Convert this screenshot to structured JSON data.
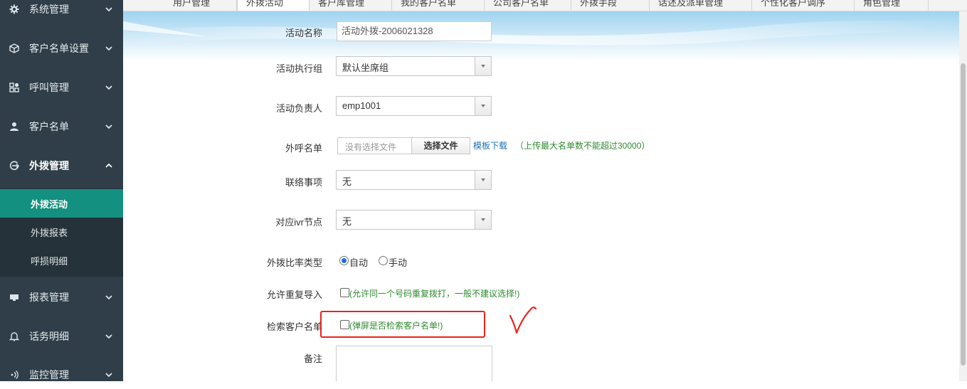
{
  "sidebar": {
    "items": [
      {
        "label": "系统管理",
        "icon": "gear-icon"
      },
      {
        "label": "客户名单设置",
        "icon": "cube-icon"
      },
      {
        "label": "呼叫管理",
        "icon": "grid-icon"
      },
      {
        "label": "客户名单",
        "icon": "user-icon"
      },
      {
        "label": "外拨管理",
        "icon": "outbound-icon",
        "expanded": true
      },
      {
        "label": "报表管理",
        "icon": "monitor-icon"
      },
      {
        "label": "话务明细",
        "icon": "bell-icon"
      },
      {
        "label": "监控管理",
        "icon": "signal-icon"
      }
    ],
    "sub_items": [
      {
        "label": "外拨活动",
        "active": true
      },
      {
        "label": "外拨报表"
      },
      {
        "label": "呼损明细"
      }
    ],
    "colors": {
      "bg": "#2f3e48",
      "active": "#13907f"
    }
  },
  "tabs": [
    {
      "label": "用户管理"
    },
    {
      "label": "外拨活动",
      "active": true
    },
    {
      "label": "客户库管理"
    },
    {
      "label": "我的客户名单"
    },
    {
      "label": "公司客户名单"
    },
    {
      "label": "外拨手段"
    },
    {
      "label": "话述及派单管理"
    },
    {
      "label": "个性化客户调序"
    },
    {
      "label": "角色管理"
    }
  ],
  "form": {
    "activity_name": {
      "label": "活动名称",
      "value": "活动外拨-2006021328"
    },
    "exec_group": {
      "label": "活动执行组",
      "value": "默认坐席组"
    },
    "owner": {
      "label": "活动负责人",
      "value": "emp1001"
    },
    "call_list": {
      "label": "外呼名单",
      "placeholder": "没有选择文件",
      "button": "选择文件",
      "template_link": "模板下载",
      "note": "（上传最大名单数不能超过30000）"
    },
    "contact_item": {
      "label": "联络事项",
      "value": "无"
    },
    "ivr_node": {
      "label": "对应ivr节点",
      "value": "无"
    },
    "ratio_type": {
      "label": "外拨比率类型",
      "options": [
        "自动",
        "手动"
      ],
      "selected": "自动"
    },
    "allow_dup": {
      "label": "允许重复导入",
      "note": "(允许同一个号码重复拨打，一般不建议选择!)",
      "checked": false
    },
    "search_customer": {
      "label": "检索客户名单",
      "note": "(弹屏是否检索客户名单!)",
      "checked": false
    },
    "remark": {
      "label": "备注",
      "value": ""
    }
  },
  "annotation": {
    "highlight_color": "#e8231e",
    "checkmark": "✓"
  }
}
